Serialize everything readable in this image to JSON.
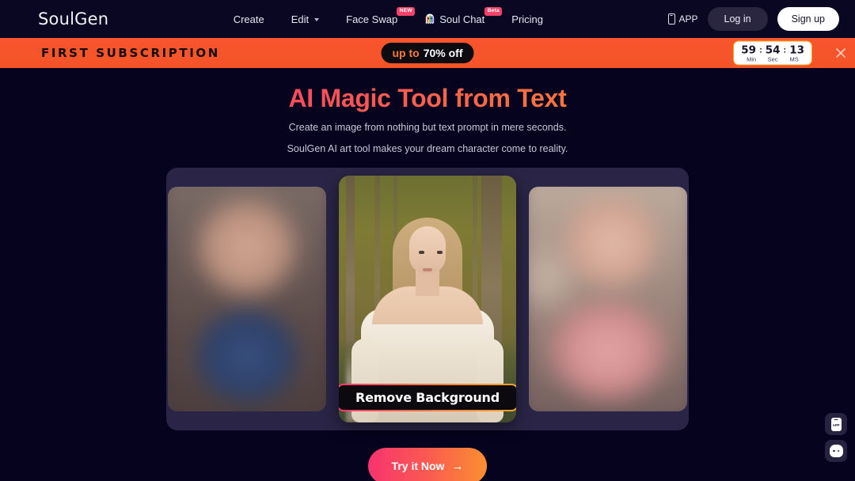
{
  "header": {
    "logo": "SoulGen",
    "nav": [
      {
        "label": "Create",
        "badge": "",
        "icon": ""
      },
      {
        "label": "Edit",
        "badge": "",
        "icon": "chevron-down-icon"
      },
      {
        "label": "Face Swap",
        "badge": "NEW",
        "icon": ""
      },
      {
        "label": "Soul Chat",
        "badge": "Beta",
        "icon": "ghost-icon"
      },
      {
        "label": "Pricing",
        "badge": "",
        "icon": ""
      }
    ],
    "app_label": "APP",
    "login_label": "Log in",
    "signup_label": "Sign up"
  },
  "promo": {
    "title": "FIRST SUBSCRIPTION",
    "discount_prefix": "up to",
    "discount_value": "70% off",
    "timer": {
      "minutes": "59",
      "seconds": "54",
      "ms": "13",
      "separator": ":",
      "min_label": "Min",
      "sec_label": "Sec",
      "ms_label": "MS"
    },
    "close_icon": "close-icon",
    "bg_color": "#f6532a"
  },
  "hero": {
    "title": "AI Magic Tool from Text",
    "subtitle_line1": "Create an image from nothing but text prompt in mere seconds.",
    "subtitle_line2": "SoulGen AI art tool makes your dream character come to reality.",
    "gradient_from": "#f8336f",
    "gradient_to": "#f99431"
  },
  "carousel": {
    "center_caption": "Remove Background",
    "slides": [
      {
        "position": "left",
        "state": "blurred"
      },
      {
        "position": "center",
        "state": "active"
      },
      {
        "position": "right",
        "state": "blurred"
      }
    ]
  },
  "cta": {
    "label": "Try it Now",
    "arrow": "→"
  },
  "floating": [
    {
      "name": "app-download",
      "label": "APP"
    },
    {
      "name": "support-chat",
      "label": ""
    }
  ]
}
